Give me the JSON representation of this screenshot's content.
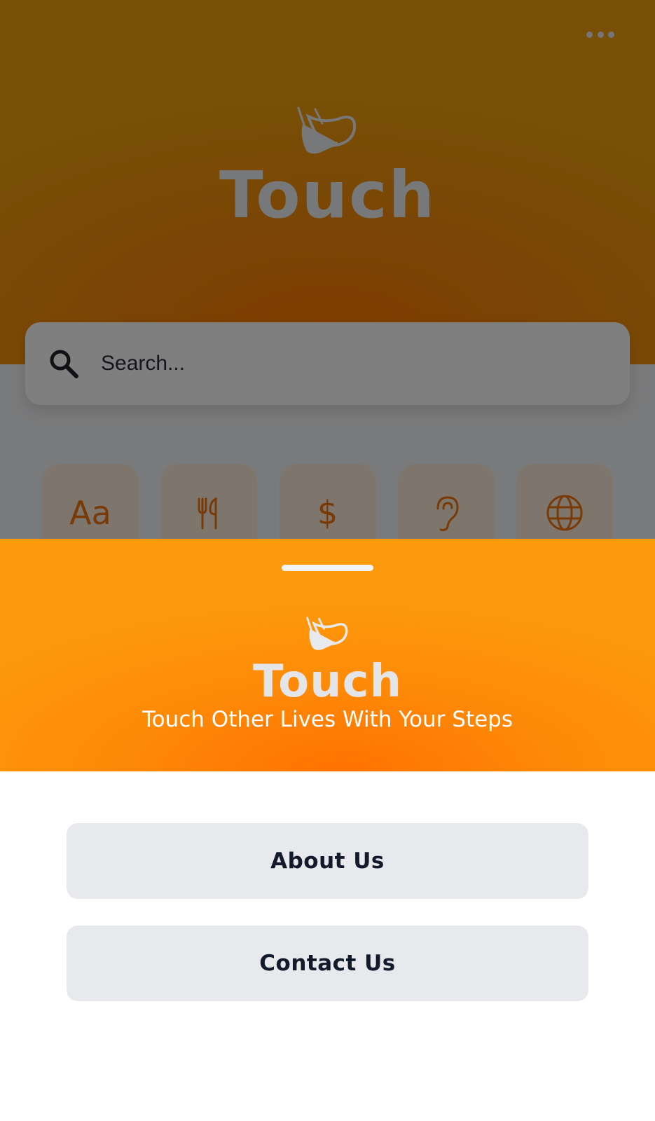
{
  "app": {
    "title": "Touch",
    "search": {
      "placeholder": "Search...",
      "value": ""
    },
    "categories": [
      {
        "icon": "text-icon",
        "glyph": "Aa"
      },
      {
        "icon": "restaurant-icon"
      },
      {
        "icon": "dollar-icon",
        "glyph": "$"
      },
      {
        "icon": "ear-icon"
      },
      {
        "icon": "globe-icon"
      }
    ],
    "menu_icon": "more-horizontal-icon"
  },
  "sheet": {
    "title": "Touch",
    "tagline": "Touch Other Lives With Your Steps",
    "buttons": {
      "about": "About Us",
      "contact": "Contact Us"
    }
  },
  "colors": {
    "accent": "#ff8a00",
    "accent_deep": "#ff7200",
    "button_bg": "#e7e9ec",
    "button_text": "#131a2b",
    "overlay": "rgba(0,0,0,0.5)"
  }
}
